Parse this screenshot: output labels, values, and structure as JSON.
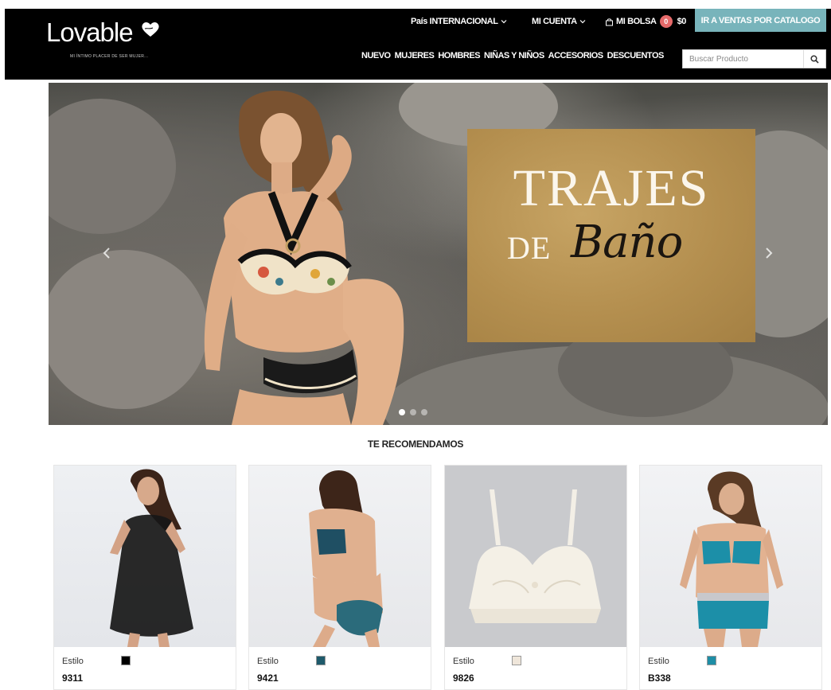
{
  "header": {
    "logo_text": "Lovable",
    "logo_tagline": "MI ÍNTIMO PLACER DE SER MUJER...",
    "country_label": "País INTERNACIONAL",
    "account_label": "MI CUENTA",
    "bag_label": "MI BOLSA",
    "bag_count": "0",
    "bag_total": "$0",
    "catalog_button": "IR A VENTAS POR CATALOGO",
    "nav": [
      "NUEVO",
      "MUJERES",
      "HOMBRES",
      "NIÑAS Y NIÑOS",
      "ACCESORIOS",
      "DESCUENTOS"
    ],
    "search_placeholder": "Buscar Producto"
  },
  "hero": {
    "title": "TRAJES",
    "subtitle_de": "DE",
    "subtitle_script": "Baño",
    "slide_count": 3,
    "active_slide": 1
  },
  "recommendations": {
    "title": "TE RECOMENDAMOS",
    "products": [
      {
        "label": "Estilo",
        "code": "9311",
        "swatch": "#000000"
      },
      {
        "label": "Estilo",
        "code": "9421",
        "swatch": "#1e5a6b"
      },
      {
        "label": "Estilo",
        "code": "9826",
        "swatch": "#efe6da"
      },
      {
        "label": "Estilo",
        "code": "B338",
        "swatch": "#1e8ea6"
      }
    ]
  },
  "colors": {
    "header_bg": "#000000",
    "catalog_accent": "#78b4bb",
    "badge": "#e66a6a",
    "banner_gold": "#b48f4f"
  },
  "icons": [
    "heart-logo-icon",
    "chevron-down-icon",
    "shopping-bag-icon",
    "search-icon",
    "chevron-left-icon",
    "chevron-right-icon"
  ]
}
